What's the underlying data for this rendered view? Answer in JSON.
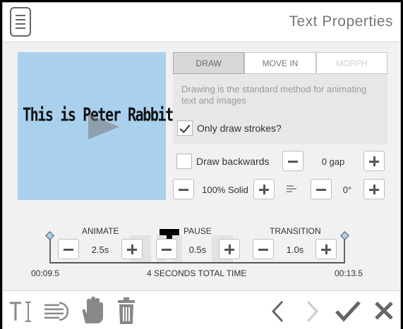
{
  "header": {
    "title": "Text Properties"
  },
  "preview": {
    "text": "This is Peter Rabbit",
    "swatch_color": "#000000"
  },
  "tabs": [
    {
      "label": "DRAW",
      "state": "active"
    },
    {
      "label": "MOVE IN",
      "state": "normal"
    },
    {
      "label": "MORPH",
      "state": "disabled"
    }
  ],
  "draw": {
    "description": "Drawing is the standard method for animating text and images",
    "only_strokes_label": "Only draw strokes?",
    "only_strokes_checked": true,
    "backwards_label": "Draw backwards",
    "backwards_checked": false,
    "gap_value": "0 gap",
    "solid_value": "100% Solid",
    "angle_value": "0°"
  },
  "timing": {
    "animate_label": "ANIMATE",
    "animate_value": "2.5s",
    "pause_label": "PAUSE",
    "pause_value": "0.5s",
    "transition_label": "TRANSITION",
    "transition_value": "1.0s",
    "start_time": "00:09.5",
    "end_time": "00:13.5",
    "total": "4 SECONDS TOTAL TIME"
  },
  "icons": {
    "menu": "document-icon",
    "text": "text-cursor-icon",
    "fill": "text-lines-icon",
    "hand": "hand-icon",
    "trash": "trash-icon",
    "prev": "chevron-left-icon",
    "next": "chevron-right-icon",
    "accept": "checkmark-icon",
    "close": "close-icon"
  }
}
